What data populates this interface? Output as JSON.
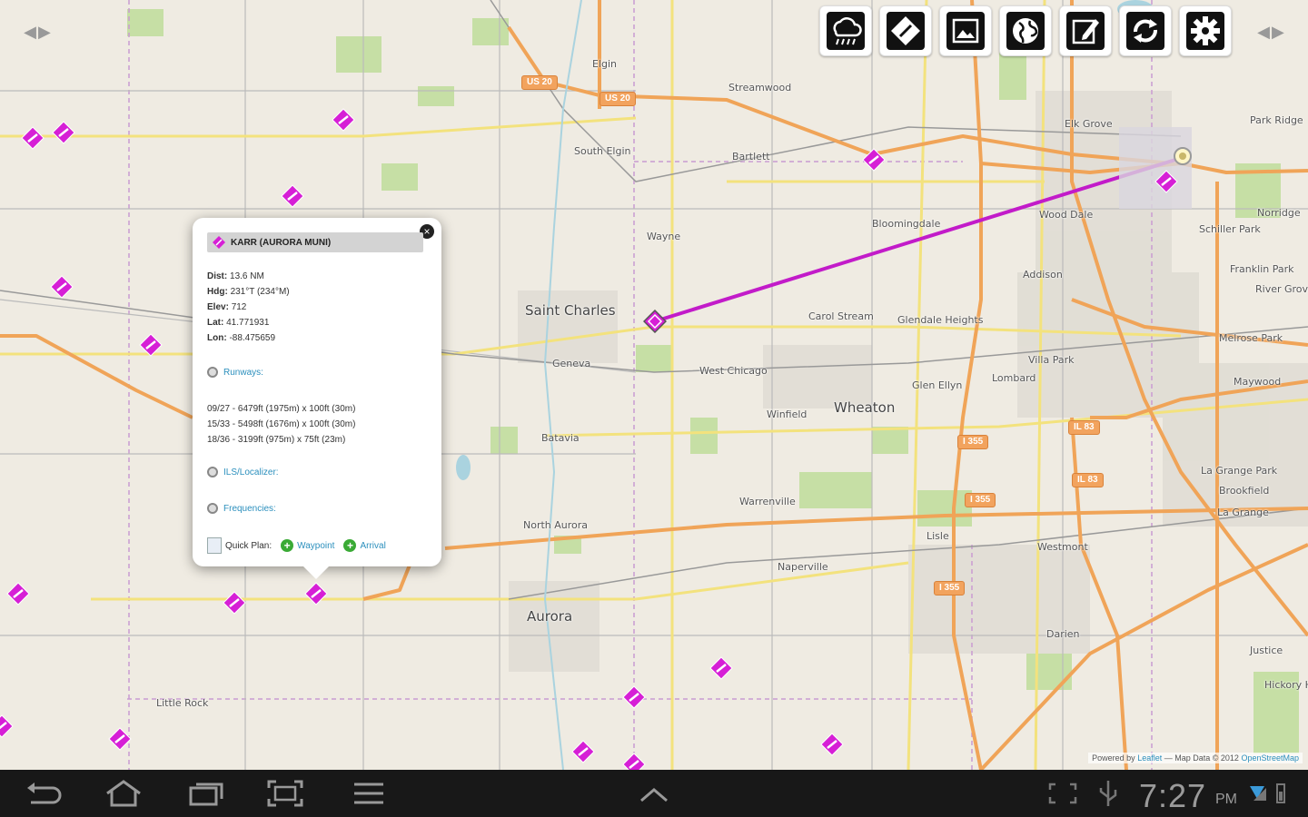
{
  "toolbar": {
    "buttons": [
      {
        "name": "weather-button",
        "icon": "cloud-rain-icon"
      },
      {
        "name": "airport-button",
        "icon": "diamond-sign-icon"
      },
      {
        "name": "image-button",
        "icon": "picture-icon"
      },
      {
        "name": "globe-button",
        "icon": "globe-icon"
      },
      {
        "name": "edit-button",
        "icon": "pencil-icon"
      },
      {
        "name": "refresh-button",
        "icon": "refresh-icon"
      },
      {
        "name": "settings-button",
        "icon": "gear-icon"
      }
    ]
  },
  "map": {
    "route_color": "#c21bc9",
    "airport_color": "#d61fd6",
    "places": {
      "elgin": "Elgin",
      "streamwood": "Streamwood",
      "bartlett": "Bartlett",
      "south_elgin": "South Elgin",
      "elk_grove": "Elk Grove",
      "park_ridge": "Park Ridge",
      "wayne": "Wayne",
      "bloomingdale": "Bloomingdale",
      "wood_dale": "Wood Dale",
      "schiller_park": "Schiller Park",
      "norridge": "Norridge",
      "franklin_park": "Franklin Park",
      "river_grove": "River Grove",
      "addison": "Addison",
      "st_charles": "Saint Charles",
      "carol_stream": "Carol Stream",
      "glendale_heights": "Glendale Heights",
      "villa_park": "Villa Park",
      "lombard": "Lombard",
      "melrose_park": "Melrose Park",
      "maywood": "Maywood",
      "geneva": "Geneva",
      "west_chicago": "West Chicago",
      "glen_ellyn": "Glen Ellyn",
      "wheaton": "Wheaton",
      "winfield": "Winfield",
      "batavia": "Batavia",
      "la_grange_park": "La Grange Park",
      "brookfield": "Brookfield",
      "la_grange": "La Grange",
      "warrenville": "Warrenville",
      "north_aurora": "North Aurora",
      "lisle": "Lisle",
      "westmont": "Westmont",
      "naperville": "Naperville",
      "aurora": "Aurora",
      "darien": "Darien",
      "justice": "Justice",
      "hickory_hills": "Hickory Hills",
      "little_rock": "Little Rock"
    },
    "shields": {
      "us20a": "US 20",
      "us20b": "US 20",
      "il83": "IL 83",
      "i355a": "I 355",
      "i355b": "I 355",
      "i355c": "I 355",
      "il83b": "IL 83",
      "i355d": "I 355"
    }
  },
  "popup": {
    "title": "KARR (AURORA MUNI)",
    "dist_label": "Dist:",
    "dist": "13.6 NM",
    "hdg_label": "Hdg:",
    "hdg": "231°T (234°M)",
    "elev_label": "Elev:",
    "elev": "712",
    "lat_label": "Lat:",
    "lat": "41.771931",
    "lon_label": "Lon:",
    "lon": "-88.475659",
    "runways_label": "Runways:",
    "runways": [
      "09/27 - 6479ft (1975m) x 100ft (30m)",
      "15/33 - 5498ft (1676m) x 100ft (30m)",
      "18/36 - 3199ft (975m) x 75ft (23m)"
    ],
    "ils_label": "ILS/Localizer:",
    "freq_label": "Frequencies:",
    "quick_plan": "Quick Plan:",
    "waypoint": "Waypoint",
    "arrival": "Arrival"
  },
  "attribution": {
    "prefix": "Powered by",
    "leaflet": "Leaflet",
    "sep": "— Map Data © 2012",
    "osm": "OpenStreetMap"
  },
  "statusbar": {
    "time": "7:27",
    "ampm": "PM"
  }
}
